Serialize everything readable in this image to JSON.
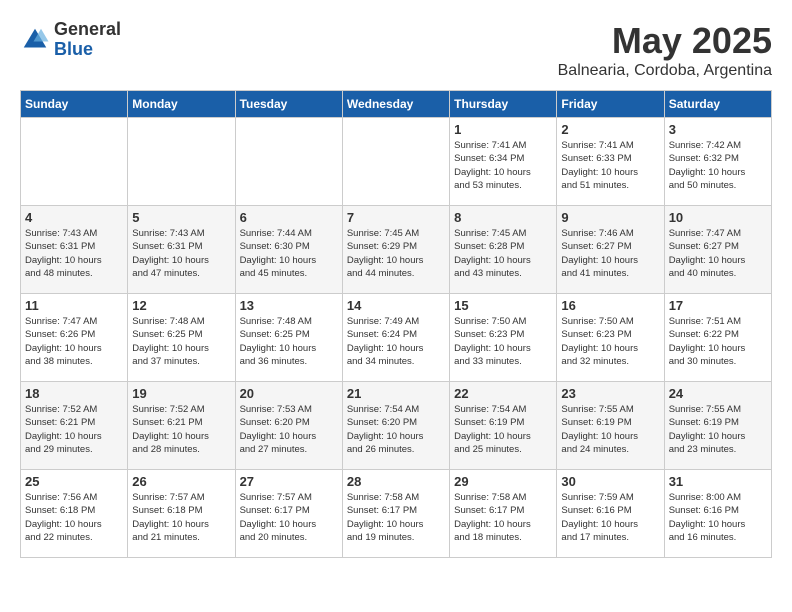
{
  "header": {
    "logo": {
      "general": "General",
      "blue": "Blue"
    },
    "title": "May 2025",
    "location": "Balnearia, Cordoba, Argentina"
  },
  "days_of_week": [
    "Sunday",
    "Monday",
    "Tuesday",
    "Wednesday",
    "Thursday",
    "Friday",
    "Saturday"
  ],
  "weeks": [
    [
      {
        "day": "",
        "info": ""
      },
      {
        "day": "",
        "info": ""
      },
      {
        "day": "",
        "info": ""
      },
      {
        "day": "",
        "info": ""
      },
      {
        "day": "1",
        "info": "Sunrise: 7:41 AM\nSunset: 6:34 PM\nDaylight: 10 hours\nand 53 minutes."
      },
      {
        "day": "2",
        "info": "Sunrise: 7:41 AM\nSunset: 6:33 PM\nDaylight: 10 hours\nand 51 minutes."
      },
      {
        "day": "3",
        "info": "Sunrise: 7:42 AM\nSunset: 6:32 PM\nDaylight: 10 hours\nand 50 minutes."
      }
    ],
    [
      {
        "day": "4",
        "info": "Sunrise: 7:43 AM\nSunset: 6:31 PM\nDaylight: 10 hours\nand 48 minutes."
      },
      {
        "day": "5",
        "info": "Sunrise: 7:43 AM\nSunset: 6:31 PM\nDaylight: 10 hours\nand 47 minutes."
      },
      {
        "day": "6",
        "info": "Sunrise: 7:44 AM\nSunset: 6:30 PM\nDaylight: 10 hours\nand 45 minutes."
      },
      {
        "day": "7",
        "info": "Sunrise: 7:45 AM\nSunset: 6:29 PM\nDaylight: 10 hours\nand 44 minutes."
      },
      {
        "day": "8",
        "info": "Sunrise: 7:45 AM\nSunset: 6:28 PM\nDaylight: 10 hours\nand 43 minutes."
      },
      {
        "day": "9",
        "info": "Sunrise: 7:46 AM\nSunset: 6:27 PM\nDaylight: 10 hours\nand 41 minutes."
      },
      {
        "day": "10",
        "info": "Sunrise: 7:47 AM\nSunset: 6:27 PM\nDaylight: 10 hours\nand 40 minutes."
      }
    ],
    [
      {
        "day": "11",
        "info": "Sunrise: 7:47 AM\nSunset: 6:26 PM\nDaylight: 10 hours\nand 38 minutes."
      },
      {
        "day": "12",
        "info": "Sunrise: 7:48 AM\nSunset: 6:25 PM\nDaylight: 10 hours\nand 37 minutes."
      },
      {
        "day": "13",
        "info": "Sunrise: 7:48 AM\nSunset: 6:25 PM\nDaylight: 10 hours\nand 36 minutes."
      },
      {
        "day": "14",
        "info": "Sunrise: 7:49 AM\nSunset: 6:24 PM\nDaylight: 10 hours\nand 34 minutes."
      },
      {
        "day": "15",
        "info": "Sunrise: 7:50 AM\nSunset: 6:23 PM\nDaylight: 10 hours\nand 33 minutes."
      },
      {
        "day": "16",
        "info": "Sunrise: 7:50 AM\nSunset: 6:23 PM\nDaylight: 10 hours\nand 32 minutes."
      },
      {
        "day": "17",
        "info": "Sunrise: 7:51 AM\nSunset: 6:22 PM\nDaylight: 10 hours\nand 30 minutes."
      }
    ],
    [
      {
        "day": "18",
        "info": "Sunrise: 7:52 AM\nSunset: 6:21 PM\nDaylight: 10 hours\nand 29 minutes."
      },
      {
        "day": "19",
        "info": "Sunrise: 7:52 AM\nSunset: 6:21 PM\nDaylight: 10 hours\nand 28 minutes."
      },
      {
        "day": "20",
        "info": "Sunrise: 7:53 AM\nSunset: 6:20 PM\nDaylight: 10 hours\nand 27 minutes."
      },
      {
        "day": "21",
        "info": "Sunrise: 7:54 AM\nSunset: 6:20 PM\nDaylight: 10 hours\nand 26 minutes."
      },
      {
        "day": "22",
        "info": "Sunrise: 7:54 AM\nSunset: 6:19 PM\nDaylight: 10 hours\nand 25 minutes."
      },
      {
        "day": "23",
        "info": "Sunrise: 7:55 AM\nSunset: 6:19 PM\nDaylight: 10 hours\nand 24 minutes."
      },
      {
        "day": "24",
        "info": "Sunrise: 7:55 AM\nSunset: 6:19 PM\nDaylight: 10 hours\nand 23 minutes."
      }
    ],
    [
      {
        "day": "25",
        "info": "Sunrise: 7:56 AM\nSunset: 6:18 PM\nDaylight: 10 hours\nand 22 minutes."
      },
      {
        "day": "26",
        "info": "Sunrise: 7:57 AM\nSunset: 6:18 PM\nDaylight: 10 hours\nand 21 minutes."
      },
      {
        "day": "27",
        "info": "Sunrise: 7:57 AM\nSunset: 6:17 PM\nDaylight: 10 hours\nand 20 minutes."
      },
      {
        "day": "28",
        "info": "Sunrise: 7:58 AM\nSunset: 6:17 PM\nDaylight: 10 hours\nand 19 minutes."
      },
      {
        "day": "29",
        "info": "Sunrise: 7:58 AM\nSunset: 6:17 PM\nDaylight: 10 hours\nand 18 minutes."
      },
      {
        "day": "30",
        "info": "Sunrise: 7:59 AM\nSunset: 6:16 PM\nDaylight: 10 hours\nand 17 minutes."
      },
      {
        "day": "31",
        "info": "Sunrise: 8:00 AM\nSunset: 6:16 PM\nDaylight: 10 hours\nand 16 minutes."
      }
    ]
  ]
}
